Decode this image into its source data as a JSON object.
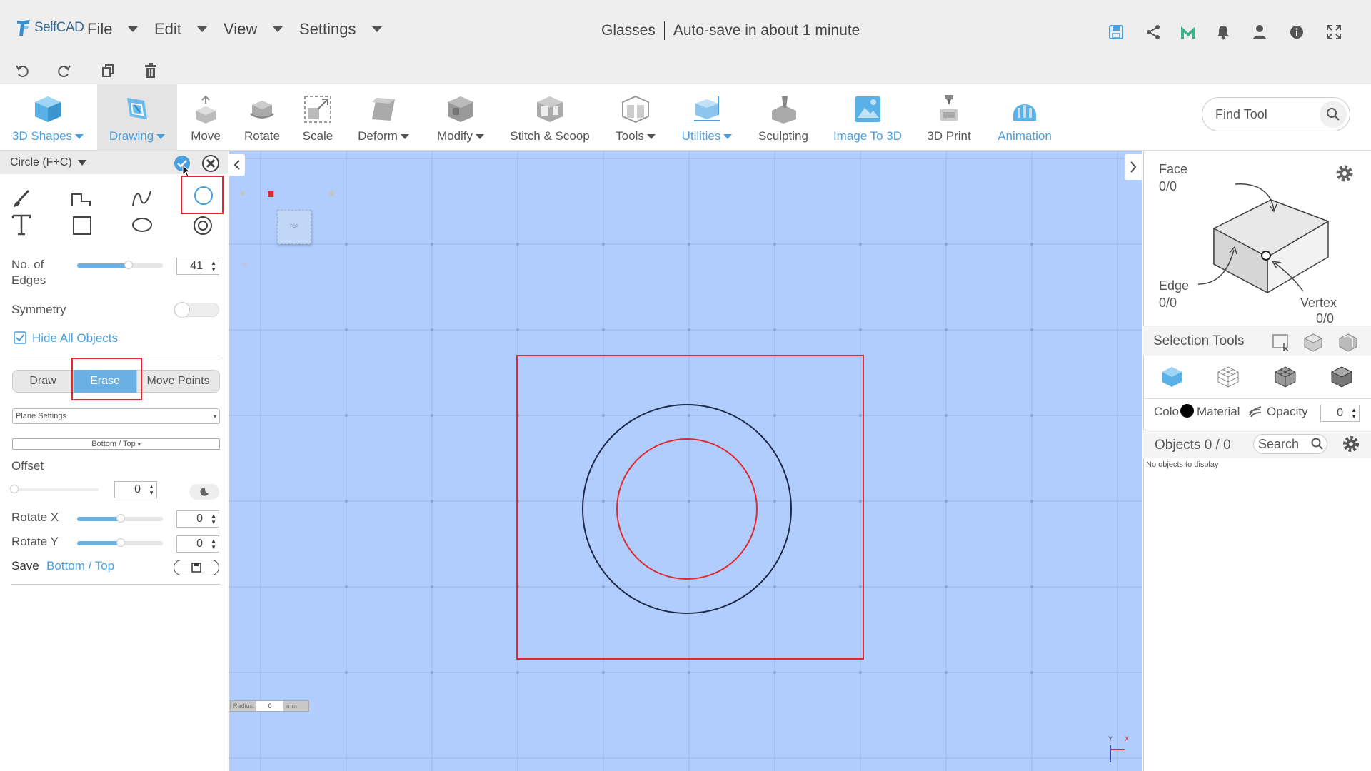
{
  "app": {
    "logo_text": "SelfCAD"
  },
  "menu": [
    {
      "label": "File"
    },
    {
      "label": "Edit"
    },
    {
      "label": "View"
    },
    {
      "label": "Settings"
    }
  ],
  "document": {
    "title": "Glasses",
    "autosave": "Auto-save in about 1 minute"
  },
  "top_icons": [
    "save-icon",
    "share-icon",
    "m-logo-icon",
    "bell-icon",
    "user-icon",
    "info-icon",
    "fullscreen-icon"
  ],
  "undo_icons": [
    "undo-icon",
    "redo-icon",
    "copy-icon",
    "trash-icon"
  ],
  "toolbar": {
    "tools": [
      {
        "label": "3D Shapes",
        "icon": "cube-icon",
        "dropdown": true
      },
      {
        "label": "Drawing",
        "icon": "drawing-icon",
        "dropdown": true
      },
      {
        "label": "Move",
        "icon": "move-icon"
      },
      {
        "label": "Rotate",
        "icon": "rotate-icon"
      },
      {
        "label": "Scale",
        "icon": "scale-icon"
      },
      {
        "label": "Deform",
        "icon": "deform-icon",
        "dropdown": true
      },
      {
        "label": "Modify",
        "icon": "modify-icon",
        "dropdown": true
      },
      {
        "label": "Stitch & Scoop",
        "icon": "stitch-icon"
      },
      {
        "label": "Tools",
        "icon": "tools-icon",
        "dropdown": true
      },
      {
        "label": "Utilities",
        "icon": "utilities-icon",
        "dropdown": true
      },
      {
        "label": "Sculpting",
        "icon": "sculpting-icon"
      },
      {
        "label": "Image To 3D",
        "icon": "image-to-3d-icon"
      },
      {
        "label": "3D Print",
        "icon": "3d-print-icon"
      },
      {
        "label": "Animation",
        "icon": "animation-icon"
      }
    ],
    "find_tool_placeholder": "Find Tool"
  },
  "left_panel": {
    "title": "Circle (F+C)",
    "edges_label": "No. of Edges",
    "edges_value": "41",
    "edges_level": 0.6,
    "symmetry_label": "Symmetry",
    "symmetry_on": false,
    "hide_all_label": "Hide All Objects",
    "hide_all_checked": true,
    "modes": [
      "Draw",
      "Erase",
      "Move Points"
    ],
    "active_mode": "Erase",
    "plane_settings": "Plane Settings",
    "plane_view": "Bottom / Top",
    "offset_label": "Offset",
    "offset_value": "0",
    "rotate_x_label": "Rotate X",
    "rotate_x_value": "0",
    "rotate_y_label": "Rotate Y",
    "rotate_y_value": "0",
    "save_label": "Save",
    "save_view": "Bottom / Top"
  },
  "viewport": {
    "gizmo_label": "TOP",
    "radius_label": "Radius:",
    "radius_value": "0",
    "radius_unit": "mm",
    "axis_y": "Y",
    "axis_x": "X",
    "bg_color": "#b1cdfd",
    "highlight_color": "#e0282e"
  },
  "right_panel": {
    "face_label": "Face",
    "face_count": "0/0",
    "edge_label": "Edge",
    "edge_count": "0/0",
    "vertex_label": "Vertex",
    "vertex_count": "0/0",
    "selection_tools_label": "Selection Tools",
    "color_label": "Colo",
    "material_label": "Material",
    "opacity_label": "Opacity",
    "opacity_value": "0",
    "objects_label": "Objects 0 / 0",
    "search_placeholder": "Search",
    "empty_text": "No objects to display"
  }
}
